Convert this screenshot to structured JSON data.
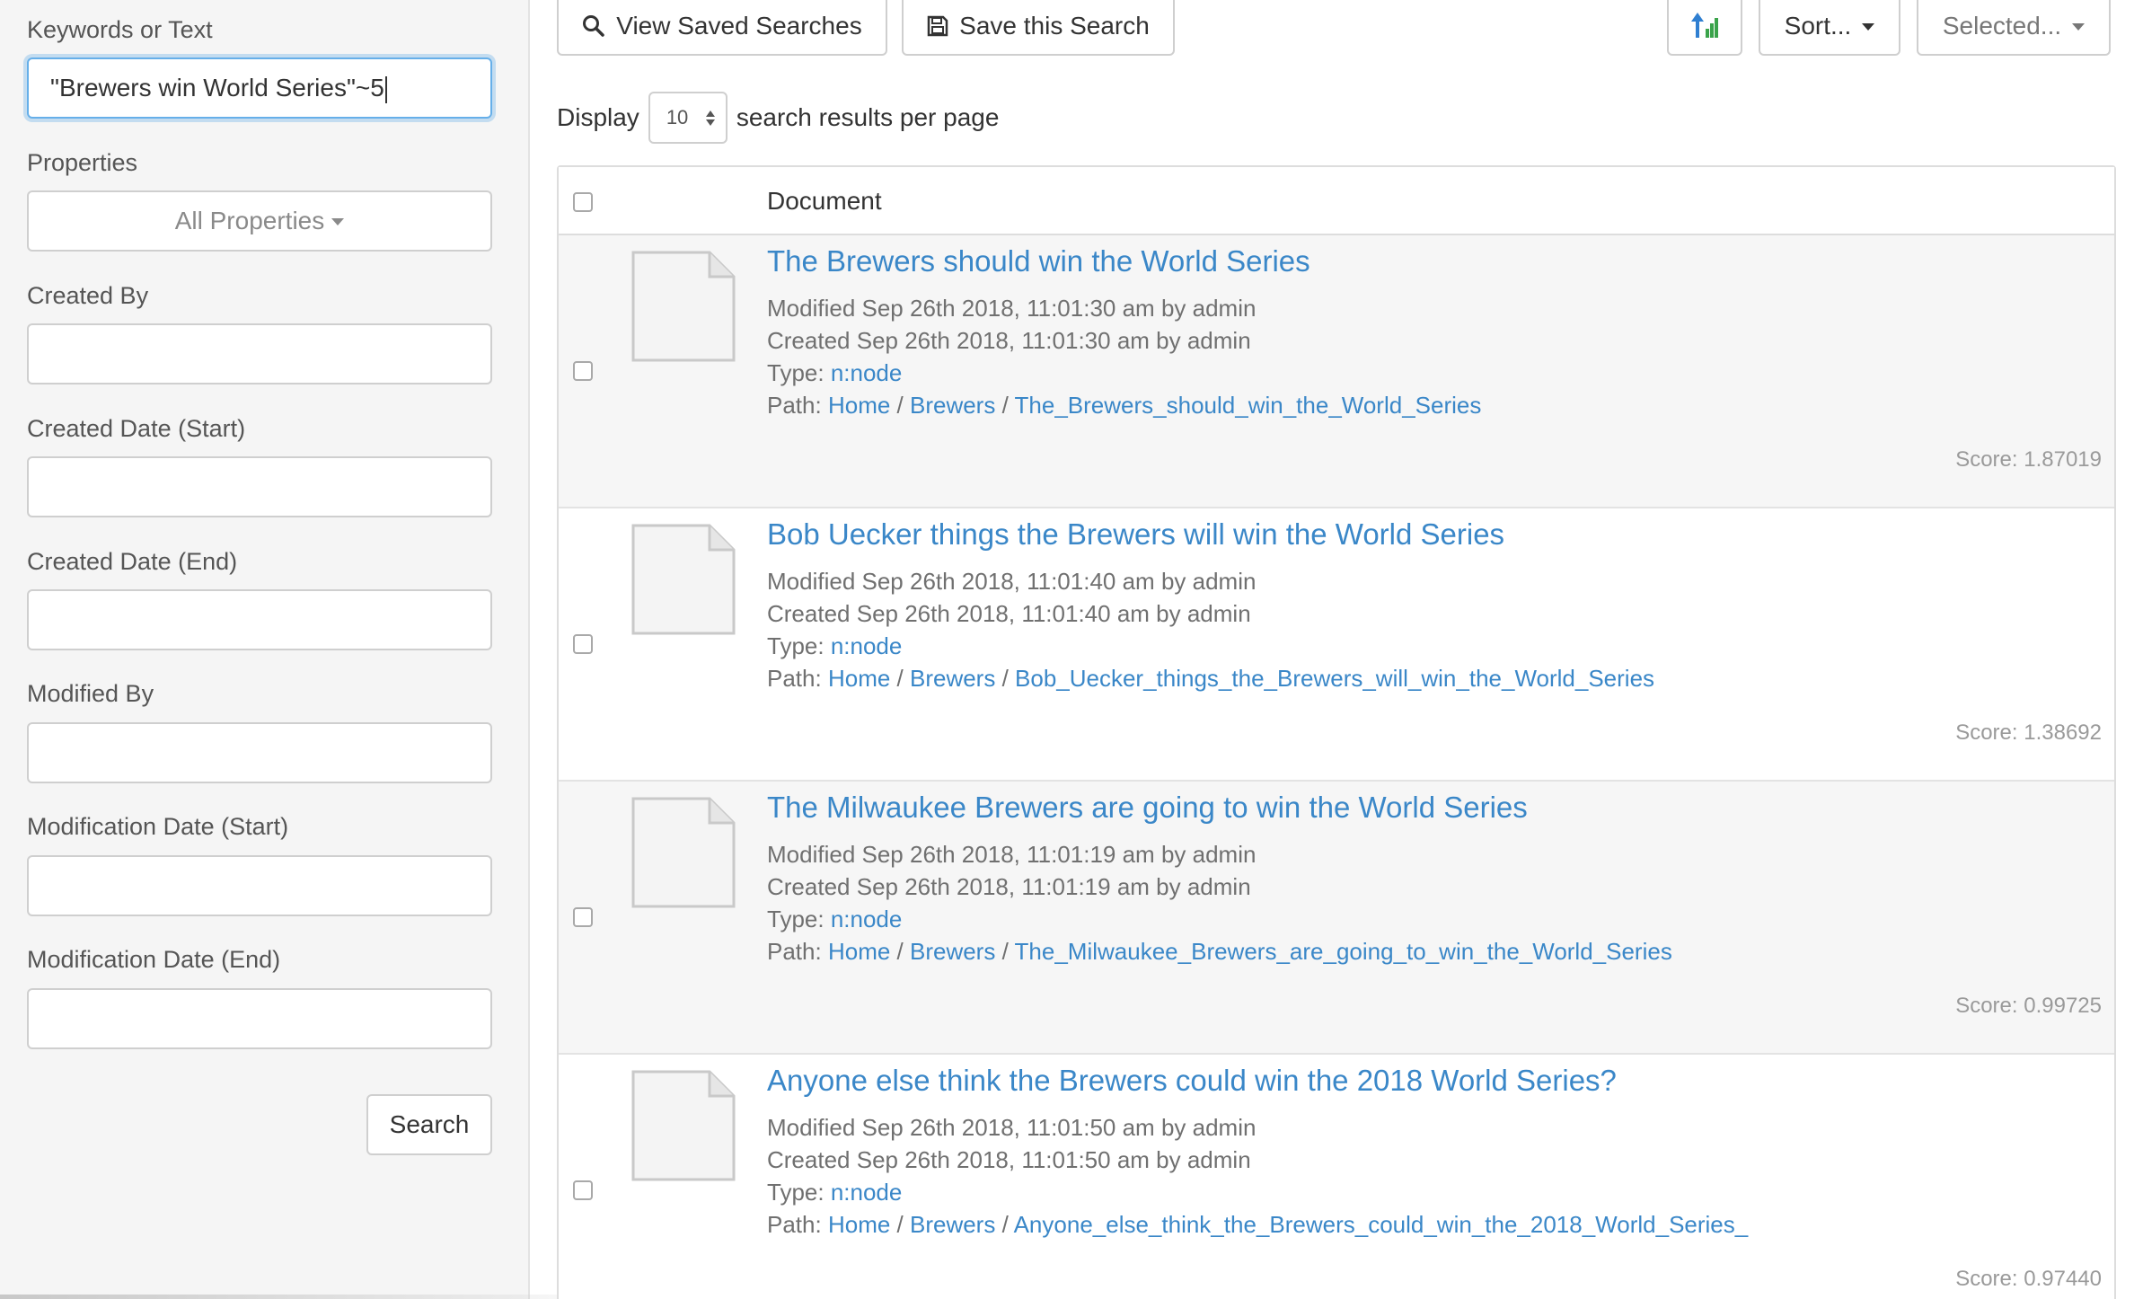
{
  "sidebar": {
    "keywords_label": "Keywords or Text",
    "keywords_value": "\"Brewers win World Series\"~5",
    "properties_label": "Properties",
    "properties_button": "All Properties",
    "created_by_label": "Created By",
    "created_date_start_label": "Created Date (Start)",
    "created_date_end_label": "Created Date (End)",
    "modified_by_label": "Modified By",
    "modification_date_start_label": "Modification Date (Start)",
    "modification_date_end_label": "Modification Date (End)",
    "search_button": "Search"
  },
  "toolbar": {
    "view_saved_searches": "View Saved Searches",
    "save_this_search": "Save this Search",
    "sort_button": "Sort...",
    "selected_button": "Selected...",
    "display_label": "Display",
    "per_page_value": "10",
    "per_page_suffix": "search results per page",
    "icons": {
      "view_saved": "search-icon",
      "save": "floppy-disk-icon",
      "sort_order": "sort-arrow-icon"
    }
  },
  "results": {
    "column_header": "Document",
    "labels": {
      "type": "Type:",
      "path": "Path:",
      "score": "Score:"
    },
    "items": [
      {
        "title": "The Brewers should win the World Series",
        "modified": "Modified Sep 26th 2018, 11:01:30 am by admin",
        "created": "Created Sep 26th 2018, 11:01:30 am by admin",
        "type": "n:node",
        "path_home": "Home",
        "path_folder": "Brewers",
        "path_leaf": "The_Brewers_should_win_the_World_Series",
        "score": "1.87019"
      },
      {
        "title": "Bob Uecker things the Brewers will win the World Series",
        "modified": "Modified Sep 26th 2018, 11:01:40 am by admin",
        "created": "Created Sep 26th 2018, 11:01:40 am by admin",
        "type": "n:node",
        "path_home": "Home",
        "path_folder": "Brewers",
        "path_leaf": "Bob_Uecker_things_the_Brewers_will_win_the_World_Series",
        "score": "1.38692"
      },
      {
        "title": "The Milwaukee Brewers are going to win the World Series",
        "modified": "Modified Sep 26th 2018, 11:01:19 am by admin",
        "created": "Created Sep 26th 2018, 11:01:19 am by admin",
        "type": "n:node",
        "path_home": "Home",
        "path_folder": "Brewers",
        "path_leaf": "The_Milwaukee_Brewers_are_going_to_win_the_World_Series",
        "score": "0.99725"
      },
      {
        "title": "Anyone else think the Brewers could win the 2018 World Series?",
        "modified": "Modified Sep 26th 2018, 11:01:50 am by admin",
        "created": "Created Sep 26th 2018, 11:01:50 am by admin",
        "type": "n:node",
        "path_home": "Home",
        "path_folder": "Brewers",
        "path_leaf": "Anyone_else_think_the_Brewers_could_win_the_2018_World_Series_",
        "score": "0.97440"
      }
    ]
  },
  "colors": {
    "link": "#3a87c8",
    "sidebar_bg": "#f5f5f5",
    "focus_border": "#66afe9",
    "row_stripe": "#f6f6f6"
  }
}
